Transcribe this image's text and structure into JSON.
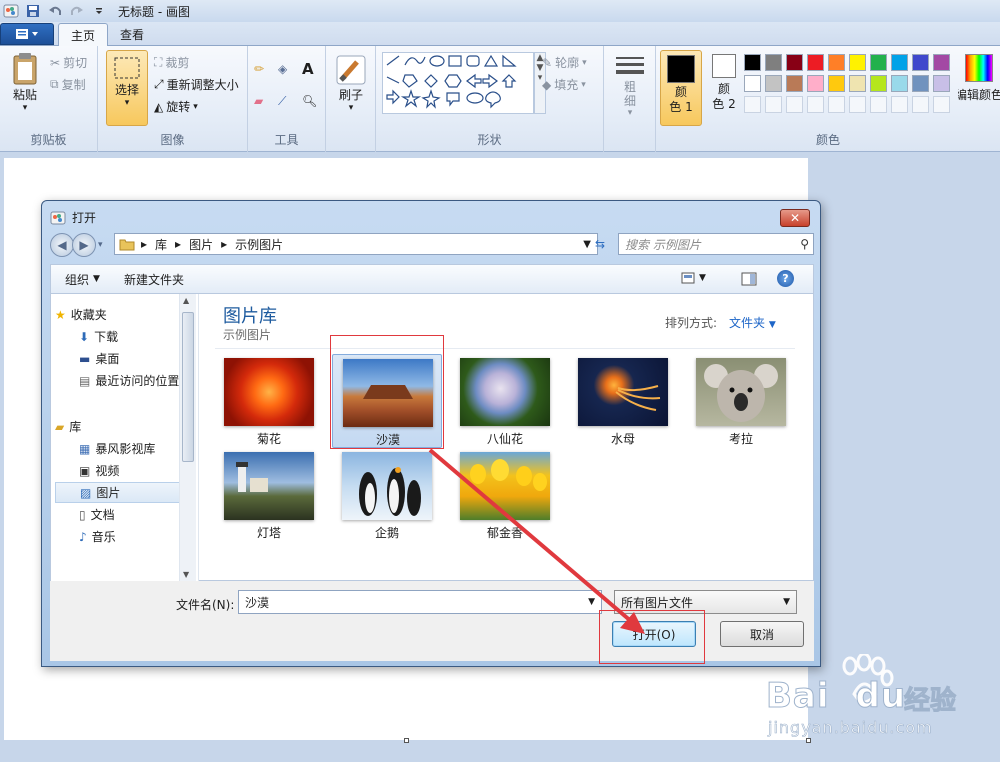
{
  "app": {
    "title": "无标题 - 画图"
  },
  "ribbon": {
    "tabs": [
      "主页",
      "查看"
    ],
    "clipboard": {
      "paste": "粘贴",
      "cut": "剪切",
      "copy": "复制",
      "label": "剪贴板"
    },
    "image": {
      "select": "选择",
      "crop": "裁剪",
      "resize": "重新调整大小",
      "rotate": "旋转",
      "label": "图像"
    },
    "tools": {
      "label": "工具"
    },
    "brushes": {
      "label": "刷子"
    },
    "shapes": {
      "outline": "轮廓",
      "fill": "填充",
      "label": "形状"
    },
    "size": {
      "label": "粗\n细"
    },
    "colors": {
      "color1": "颜\n色 1",
      "color2": "颜\n色 2",
      "label": "颜色",
      "edit": "编辑颜色",
      "palette_row1": [
        "#000000",
        "#7f7f7f",
        "#880015",
        "#ed1c24",
        "#ff7f27",
        "#fff200",
        "#22b14c",
        "#00a2e8",
        "#3f48cc",
        "#a349a4"
      ],
      "palette_row2": [
        "#ffffff",
        "#c3c3c3",
        "#b97a57",
        "#ffaec9",
        "#ffc90e",
        "#efe4b0",
        "#b5e61d",
        "#99d9ea",
        "#7092be",
        "#c8bfe7"
      ]
    }
  },
  "dialog": {
    "title": "打开",
    "breadcrumb": [
      "库",
      "图片",
      "示例图片"
    ],
    "search_placeholder": "搜索 示例图片",
    "toolbar": {
      "organize": "组织",
      "new_folder": "新建文件夹"
    },
    "nav": {
      "favorites": "收藏夹",
      "downloads": "下载",
      "desktop": "桌面",
      "recent": "最近访问的位置",
      "libraries": "库",
      "storm": "暴风影视库",
      "videos": "视频",
      "pictures": "图片",
      "documents": "文档",
      "music": "音乐"
    },
    "library_title": "图片库",
    "library_sub": "示例图片",
    "sort_label": "排列方式:",
    "sort_value": "文件夹",
    "files": [
      "菊花",
      "沙漠",
      "八仙花",
      "水母",
      "考拉",
      "灯塔",
      "企鹅",
      "郁金香"
    ],
    "selected_file": "沙漠",
    "filename_label": "文件名(N):",
    "filename_value": "沙漠",
    "filetype_value": "所有图片文件",
    "open_button": "打开(O)",
    "cancel_button": "取消"
  },
  "watermark": {
    "brand": "Bai",
    "brand2": "du",
    "cn": "经验",
    "url": "jingyan.baidu.com"
  }
}
